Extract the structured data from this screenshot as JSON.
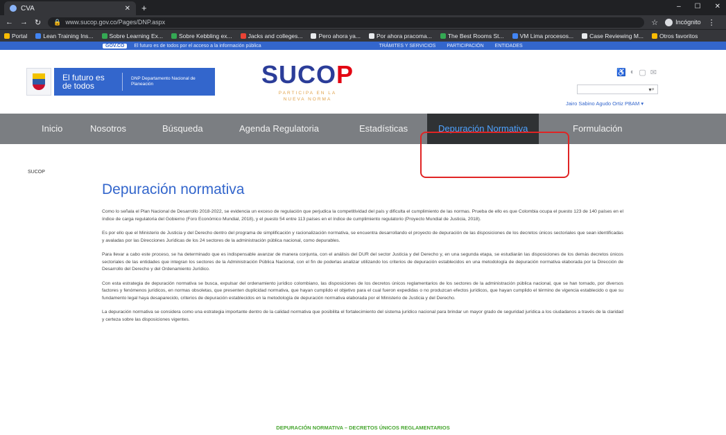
{
  "browser": {
    "tab_title": "CVA",
    "url": "www.sucop.gov.co/Pages/DNP.aspx",
    "profile_label": "Incógnito",
    "bookmarks": [
      "Portal",
      "Lean Training Ins...",
      "Sobre Learning Ex...",
      "Sobre Kebbling ex...",
      "Jacks and colleges...",
      "Pero ahora ya...",
      "Por ahora pracoma...",
      "The Best Rooms St...",
      "VM Lima procesos...",
      "Case Reviewing M...",
      "Otros favoritos"
    ]
  },
  "gov_bar": {
    "logo": "GOV.CO",
    "text": "El futuro es de todos por el acceso a la información pública",
    "links": [
      "TRÁMITES Y SERVICIOS",
      "PARTICIPACIÓN",
      "ENTIDADES"
    ]
  },
  "header": {
    "slogan": "El futuro es de todos",
    "dnp": "DNP Departamento Nacional de Planeación",
    "logo_text": "SUCO",
    "logo_accent": "P",
    "tagline_1": "PARTICIPA EN LA",
    "tagline_2": "NUEVA NORMA",
    "user": "Jairo Sabino Agudo Ortiz PBAM ▾"
  },
  "nav": [
    "Inicio",
    "Nosotros",
    "Búsqueda",
    "Agenda Regulatoria",
    "Estadísticas",
    "Depuración Normativa",
    "Formulación"
  ],
  "breadcrumb": "SUCOP",
  "page": {
    "title": "Depuración normativa",
    "paragraphs": [
      "Como lo señala el Plan Nacional de Desarrollo 2018-2022, se evidencia un exceso de regulación que perjudica la competitividad del país y dificulta el cumplimiento de las normas. Prueba de ello es que Colombia ocupa el puesto 123 de 140 países en el índice de carga regulatoria del Gobierno (Foro Económico Mundial, 2018), y el puesto 54 entre 113 países en el índice de cumplimiento regulatorio (Proyecto Mundial de Justicia, 2018).",
      "Es por ello que el Ministerio de Justicia y del Derecho dentro del programa de simplificación y racionalización normativa, se encuentra desarrollando el proyecto de depuración de las disposiciones de los decretos únicos sectoriales que sean identificadas y avaladas por las Direcciones Jurídicas de los 24 sectores de la administración pública nacional, como depurables.",
      "Para llevar a cabo este proceso, se ha determinado que es indispensable avanzar de manera conjunta, con el análisis del DUR del sector Justicia y del Derecho y, en una segunda etapa, se estudiarán las disposiciones de los demás decretos únicos sectoriales de las entidades que integran los sectores de la Administración Pública Nacional, con el fin de poderlas analizar utilizando los criterios de depuración establecidos en una metodología de depuración normativa elaborada por la Dirección de Desarrollo del Derecho y del Ordenamiento Jurídico.",
      "Con esta estrategia de depuración normativa se busca, expulsar del ordenamiento jurídico colombiano, las disposiciones de los decretos únicos reglamentarios de los sectores de la administración pública nacional, que se han tornado, por diversos factores y fenómenos jurídicos, en normas obsoletas, que presenten duplicidad normativa, que hayan cumplido el objetivo para el cual fueron expedidas o no produzcan efectos jurídicos, que hayan cumplido el término de vigencia establecido o que su fundamento legal haya desaparecido, criterios de depuración establecidos en la metodología de depuración normativa elaborada por el Ministerio de Justicia y del Derecho.",
      "La depuración normativa se considera como una estrategia importante dentro de la calidad normativa que posibilita el fortalecimiento del sistema jurídico nacional para brindar un mayor grado de seguridad jurídica a los ciudadanos a través de la claridad y certeza sobre las disposiciones vigentes."
    ],
    "section_title": "DEPURACIÓN NORMATIVA – DECRETOS ÚNICOS REGLAMENTARIOS"
  },
  "colors": {
    "gov_blue": "#3366cc",
    "nav_gray": "#7b7e82",
    "active_bg": "#2f3234",
    "accent_red": "#e30613",
    "green": "#45a52e"
  }
}
